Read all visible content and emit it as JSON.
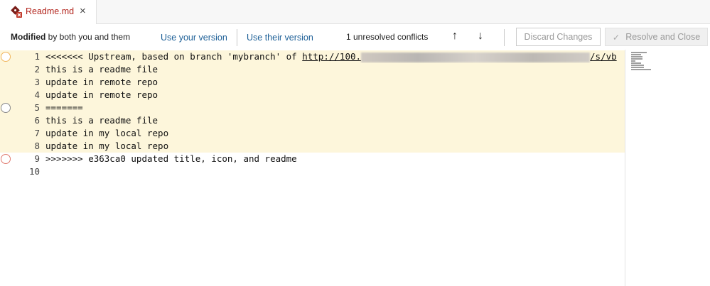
{
  "tab": {
    "label": "Readme.md",
    "close": "×"
  },
  "toolbar": {
    "status_bold": "Modified",
    "status_rest": " by both you and them",
    "use_your_version": "Use your version",
    "use_their_version": "Use their version",
    "conflicts": "1 unresolved conflicts",
    "prev_arrow": "↑",
    "next_arrow": "↓",
    "discard": "Discard Changes",
    "resolve_check": "✓",
    "resolve": "Resolve and Close"
  },
  "editor": {
    "lines": [
      {
        "n": "1",
        "pre": "<<<<<<< Upstream, based on branch 'mybranch' of ",
        "url": "http://100.",
        "post": "/s/vb"
      },
      {
        "n": "2",
        "text": "this is a readme file"
      },
      {
        "n": "3",
        "text": "update in remote repo"
      },
      {
        "n": "4",
        "text": "update in remote repo"
      },
      {
        "n": "5",
        "text": "======="
      },
      {
        "n": "6",
        "text": "this is a readme file"
      },
      {
        "n": "7",
        "text": "update in my local repo"
      },
      {
        "n": "8",
        "text": "update in my local repo"
      },
      {
        "n": "9",
        "text": ">>>>>>> e363ca0 updated title, icon, and readme"
      },
      {
        "n": "10",
        "text": ""
      }
    ]
  },
  "colors": {
    "accent_link": "#1b5e96",
    "tab_label": "#b3261e",
    "marker_upstream": "#f0b45a",
    "marker_separator": "#8a8a8a",
    "marker_local": "#e07a6e",
    "conflict_highlight": "#fdf6db"
  }
}
